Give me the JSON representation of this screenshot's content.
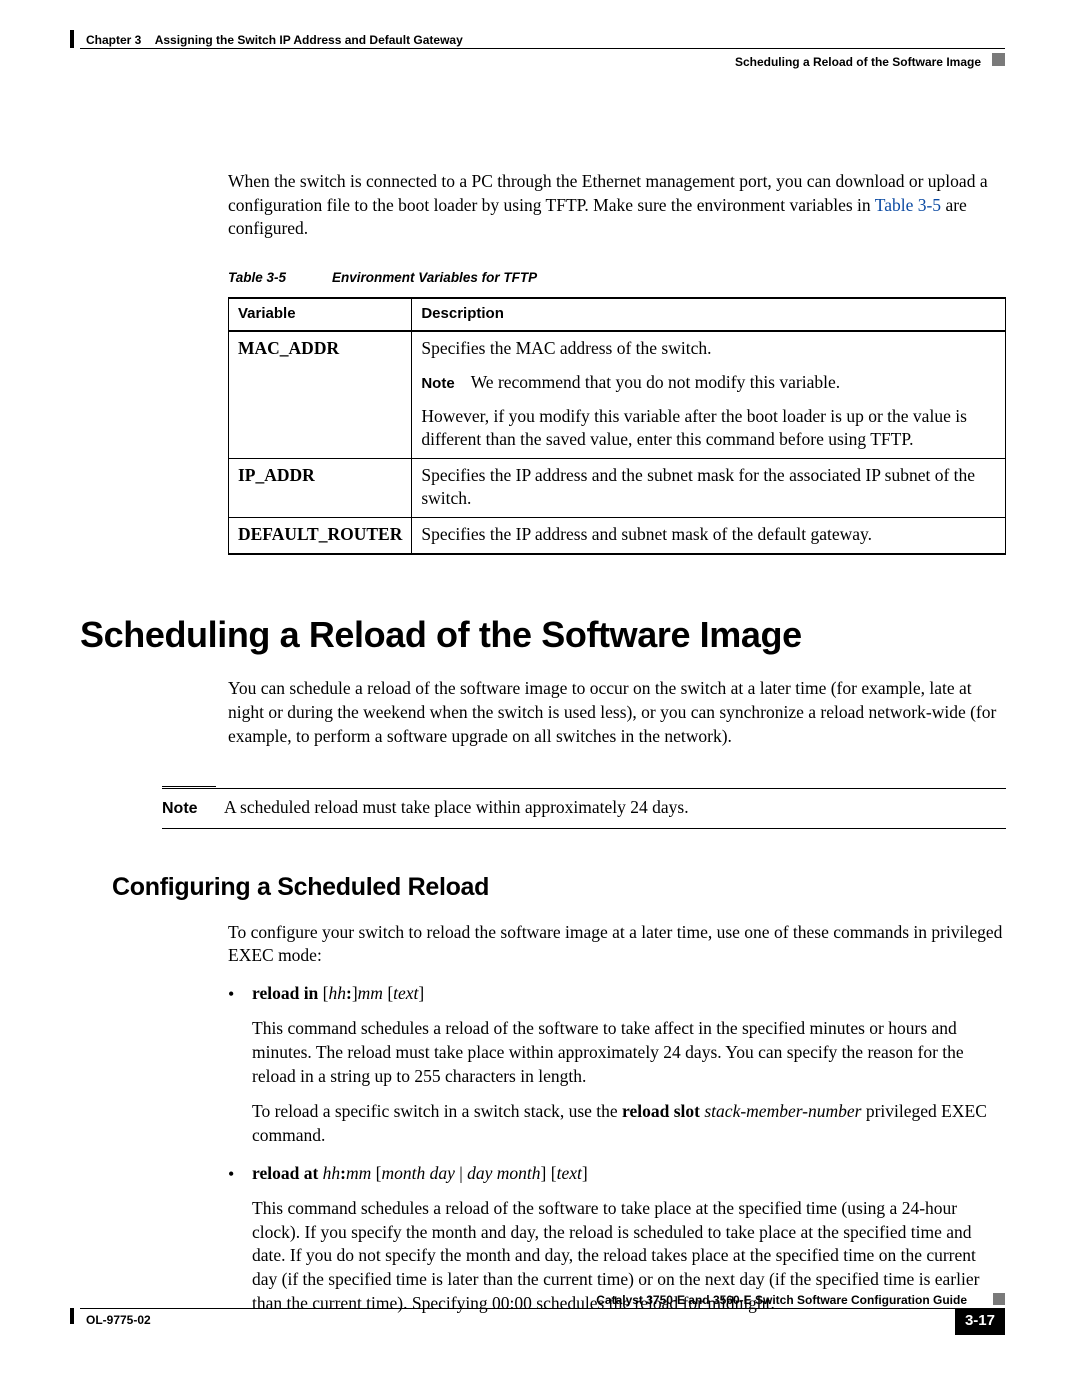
{
  "header": {
    "chapter_label": "Chapter 3",
    "chapter_title": "Assigning the Switch IP Address and Default Gateway",
    "section_title": "Scheduling a Reload of the Software Image"
  },
  "intro": {
    "p1a": "When the switch is connected to a PC through the Ethernet management port, you can download or upload a configuration file to the boot loader by using TFTP. Make sure the environment variables in ",
    "link": "Table 3-5",
    "p1b": " are configured."
  },
  "table": {
    "caption_num": "Table 3-5",
    "caption_title": "Environment Variables for TFTP",
    "col1": "Variable",
    "col2": "Description",
    "rows": {
      "r1": {
        "var": "MAC_ADDR",
        "d1": "Specifies the MAC address of the switch.",
        "note_label": "Note",
        "d2": "We recommend that you do not modify this variable.",
        "d3": "However, if you modify this variable after the boot loader is up or the value is different than the saved value, enter this command before using TFTP."
      },
      "r2": {
        "var": "IP_ADDR",
        "d1": "Specifies the IP address and the subnet mask for the associated IP subnet of the switch."
      },
      "r3": {
        "var": "DEFAULT_ROUTER",
        "d1": "Specifies the IP address and subnet mask of the default gateway."
      }
    }
  },
  "h1": "Scheduling a Reload of the Software Image",
  "p2": "You can schedule a reload of the software image to occur on the switch at a later time (for example, late at night or during the weekend when the switch is used less), or you can synchronize a reload network-wide (for example, to perform a software upgrade on all switches in the network).",
  "note": {
    "label": "Note",
    "text": "A scheduled reload must take place within approximately 24 days."
  },
  "h2": "Configuring a Scheduled Reload",
  "p3": "To configure your switch to reload the software image at a later time, use one of these commands in privileged EXEC mode:",
  "cmds": {
    "c1": {
      "cmd": "reload in",
      "syntax_hh": "hh",
      "colon": ":",
      "syntax_mm": "mm",
      "syntax_text": "text",
      "d1": "This command schedules a reload of the software to take affect in the specified minutes or hours and minutes. The reload must take place within approximately 24 days. You can specify the reason for the reload in a string up to 255 characters in length.",
      "d2a": "To reload a specific switch in a switch stack, use the ",
      "d2b": "reload slot",
      "d2c": " stack-member-number",
      "d2d": " privileged EXEC command."
    },
    "c2": {
      "cmd": "reload at",
      "syntax_hh": "hh",
      "colon": ":",
      "syntax_mm": "mm",
      "syntax_md": "month day",
      "pipe": " | ",
      "syntax_dm": "day month",
      "syntax_text": "text",
      "d1": "This command schedules a reload of the software to take place at the specified time (using a 24-hour clock). If you specify the month and day, the reload is scheduled to take place at the specified time and date. If you do not specify the month and day, the reload takes place at the specified time on the current day (if the specified time is later than the current time) or on the next day (if the specified time is earlier than the current time). Specifying 00:00 schedules the reload for midnight."
    }
  },
  "footer": {
    "title": "Catalyst 3750-E and 3560-E Switch Software Configuration Guide",
    "doc": "OL-9775-02",
    "page": "3-17"
  }
}
